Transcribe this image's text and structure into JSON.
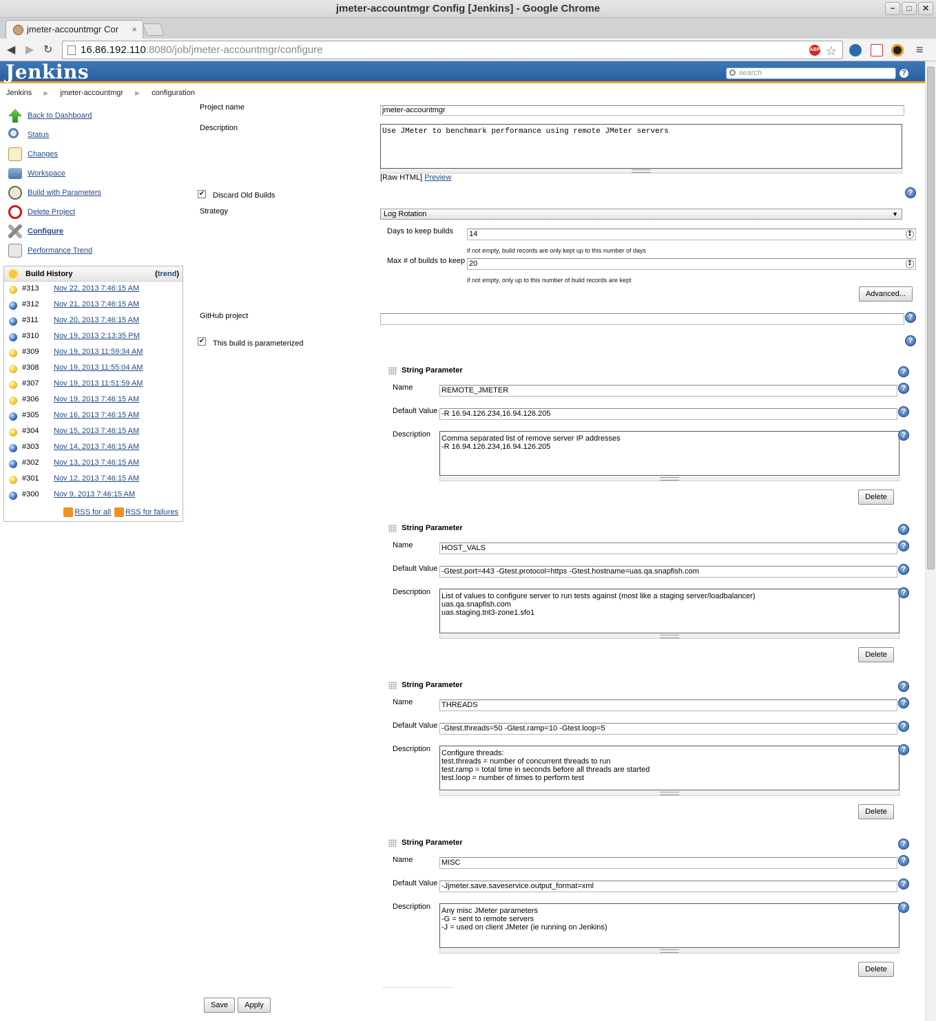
{
  "window": {
    "title": "jmeter-accountmgr Config [Jenkins] - Google Chrome"
  },
  "browser": {
    "tab_title": "jmeter-accountmgr Cor",
    "url_host": "16.86.192.110",
    "url_rest": ":8080/job/jmeter-accountmgr/configure",
    "abp_label": "ABP"
  },
  "jenkins": {
    "logo": "Jenkins",
    "search_placeholder": "search",
    "help": "?"
  },
  "breadcrumbs": [
    "Jenkins",
    "jmeter-accountmgr",
    "configuration"
  ],
  "sidebar": {
    "tasks": [
      {
        "label": "Back to Dashboard",
        "icon": "up-arrow-icon"
      },
      {
        "label": "Status",
        "icon": "magnifier-icon"
      },
      {
        "label": "Changes",
        "icon": "notepad-icon"
      },
      {
        "label": "Workspace",
        "icon": "folder-icon"
      },
      {
        "label": "Build with Parameters",
        "icon": "clock-build-icon"
      },
      {
        "label": "Delete Project",
        "icon": "no-entry-icon"
      },
      {
        "label": "Configure",
        "icon": "tools-icon"
      },
      {
        "label": "Performance Trend",
        "icon": "graph-icon"
      }
    ]
  },
  "build_history": {
    "title": "Build History",
    "trend_open": "(",
    "trend": "trend",
    "trend_close": ")",
    "rss_all": "RSS for all",
    "rss_failures": "RSS for failures",
    "builds": [
      {
        "num": "#313",
        "date": "Nov 22, 2013 7:46:15 AM",
        "status": "yellow"
      },
      {
        "num": "#312",
        "date": "Nov 21, 2013 7:46:15 AM",
        "status": "blue"
      },
      {
        "num": "#311",
        "date": "Nov 20, 2013 7:46:15 AM",
        "status": "blue"
      },
      {
        "num": "#310",
        "date": "Nov 19, 2013 2:13:35 PM",
        "status": "blue"
      },
      {
        "num": "#309",
        "date": "Nov 19, 2013 11:59:34 AM",
        "status": "yellow"
      },
      {
        "num": "#308",
        "date": "Nov 19, 2013 11:55:04 AM",
        "status": "yellow"
      },
      {
        "num": "#307",
        "date": "Nov 19, 2013 11:51:59 AM",
        "status": "yellow"
      },
      {
        "num": "#306",
        "date": "Nov 19, 2013 7:46:15 AM",
        "status": "yellow"
      },
      {
        "num": "#305",
        "date": "Nov 16, 2013 7:46:15 AM",
        "status": "blue"
      },
      {
        "num": "#304",
        "date": "Nov 15, 2013 7:46:15 AM",
        "status": "yellow"
      },
      {
        "num": "#303",
        "date": "Nov 14, 2013 7:46:15 AM",
        "status": "blue"
      },
      {
        "num": "#302",
        "date": "Nov 13, 2013 7:46:15 AM",
        "status": "blue"
      },
      {
        "num": "#301",
        "date": "Nov 12, 2013 7:46:15 AM",
        "status": "yellow"
      },
      {
        "num": "#300",
        "date": "Nov 9, 2013 7:46:15 AM",
        "status": "blue"
      }
    ]
  },
  "form": {
    "project_name_label": "Project name",
    "project_name": "jmeter-accountmgr",
    "description_label": "Description",
    "description": "Use JMeter to benchmark performance using remote JMeter servers",
    "raw_html": "[Raw HTML]",
    "preview": "Preview",
    "discard_old_builds": "Discard Old Builds",
    "strategy_label": "Strategy",
    "strategy": "Log Rotation",
    "days_label": "Days to keep builds",
    "days_value": "14",
    "days_hint": "if not empty, build records are only kept up to this number of days",
    "max_label": "Max # of builds to keep",
    "max_value": "20",
    "max_hint": "if not empty, only up to this number of build records are kept",
    "advanced": "Advanced...",
    "github_label": "GitHub project",
    "github_value": "",
    "parameterized": "This build is parameterized",
    "param_type": "String Parameter",
    "name_label": "Name",
    "default_label": "Default Value",
    "desc_label": "Description",
    "delete": "Delete",
    "save": "Save",
    "apply": "Apply",
    "params": [
      {
        "name": "REMOTE_JMETER",
        "default": "-R 16.94.126.234,16.94.126.205",
        "description": "Comma separated list of remove server IP addresses\n-R 16.94.126.234,16.94.126.205"
      },
      {
        "name": "HOST_VALS",
        "default": "-Gtest.port=443 -Gtest.protocol=https -Gtest.hostname=uas.qa.snapfish.com",
        "description": "List of values to configure server to run tests against (most like a staging server/loadbalancer)\nuas.qa.snapfish.com\nuas.staging.tnt3-zone1.sfo1"
      },
      {
        "name": "THREADS",
        "default": "-Gtest.threads=50 -Gtest.ramp=10 -Gtest.loop=5",
        "description": "Configure threads:\ntest.threads = number of concurrent threads to run\ntest.ramp = total time in seconds before all threads are started\ntest.loop = number of times to perform test"
      },
      {
        "name": "MISC",
        "default": "-Jjmeter.save.saveservice.output_format=xml",
        "description": "Any misc JMeter parameters\n-G = sent to remote servers\n-J = used on client JMeter (ie running on Jenkins)"
      }
    ]
  }
}
